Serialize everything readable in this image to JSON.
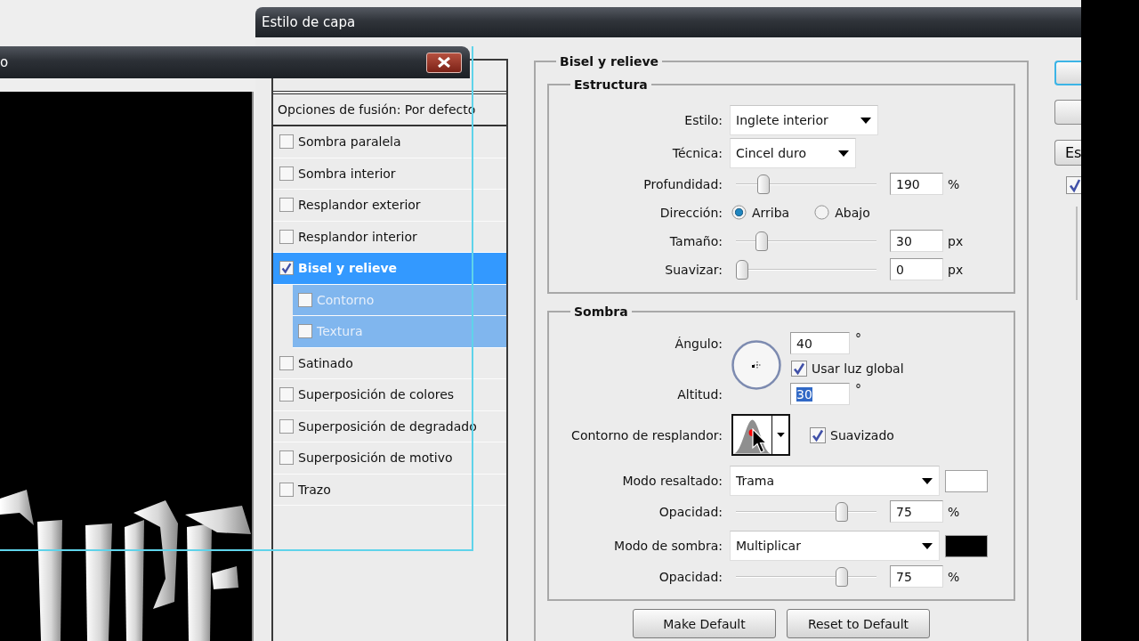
{
  "document_window": {
    "title": "o"
  },
  "dialog": {
    "title": "Estilo de capa",
    "styles": {
      "blend_options": "Opciones de fusión: Por defecto",
      "items": [
        {
          "label": "Sombra paralela",
          "checked": false,
          "selected": false
        },
        {
          "label": "Sombra interior",
          "checked": false,
          "selected": false
        },
        {
          "label": "Resplandor exterior",
          "checked": false,
          "selected": false
        },
        {
          "label": "Resplandor interior",
          "checked": false,
          "selected": false
        },
        {
          "label": "Bisel y relieve",
          "checked": true,
          "selected": true,
          "children": [
            {
              "label": "Contorno",
              "checked": false,
              "selected": false
            },
            {
              "label": "Textura",
              "checked": false,
              "selected": false
            }
          ]
        },
        {
          "label": "Satinado",
          "checked": false,
          "selected": false
        },
        {
          "label": "Superposición de colores",
          "checked": false,
          "selected": false
        },
        {
          "label": "Superposición de degradado",
          "checked": false,
          "selected": false
        },
        {
          "label": "Superposición de motivo",
          "checked": false,
          "selected": false
        },
        {
          "label": "Trazo",
          "checked": false,
          "selected": false
        }
      ]
    },
    "panel": {
      "title": "Bisel y relieve",
      "groups": [
        {
          "title": "Estructura",
          "rows": [
            {
              "kind": "select",
              "label": "Estilo:",
              "value": "Inglete interior"
            },
            {
              "kind": "select",
              "label": "Técnica:",
              "value": "Cincel duro"
            },
            {
              "kind": "slider",
              "label": "Profundidad:",
              "level": 0.17,
              "value": "190",
              "unit": "%"
            },
            {
              "kind": "radio",
              "label": "Dirección:",
              "options": [
                {
                  "label": "Arriba",
                  "selected": true
                },
                {
                  "label": "Abajo",
                  "selected": false
                }
              ]
            },
            {
              "kind": "slider",
              "label": "Tamaño:",
              "level": 0.15,
              "value": "30",
              "unit": "px"
            },
            {
              "kind": "slider",
              "label": "Suavizar:",
              "level": 0,
              "value": "0",
              "unit": "px"
            }
          ]
        },
        {
          "title": "Sombra",
          "rows": [
            {
              "kind": "angle",
              "label": "Ángulo:",
              "value": "40",
              "unit": "°",
              "global_light": {
                "label": "Usar luz global",
                "checked": true
              },
              "altitude": {
                "label": "Altitud:",
                "value": "30",
                "unit": "°",
                "text_selected": true
              }
            },
            {
              "kind": "contour",
              "label": "Contorno de resplandor:",
              "antialias": {
                "label": "Suavizado",
                "checked": true
              }
            },
            {
              "kind": "mode",
              "label": "Modo resaltado:",
              "value": "Trama",
              "color": "#ffffff"
            },
            {
              "kind": "slider",
              "label": "Opacidad:",
              "level": 0.78,
              "value": "75",
              "unit": "%"
            },
            {
              "kind": "mode",
              "label": "Modo de sombra:",
              "value": "Multiplicar",
              "color": "#000000"
            },
            {
              "kind": "slider",
              "label": "Opacidad:",
              "level": 0.78,
              "value": "75",
              "unit": "%"
            }
          ]
        }
      ],
      "buttons": [
        "Make Default",
        "Reset to Default"
      ]
    },
    "side": {
      "buttons": [
        {
          "focused": true
        },
        {
          "focused": false
        },
        {
          "label": "Es",
          "focused": false
        }
      ],
      "checkbox": {
        "checked": true
      }
    }
  }
}
